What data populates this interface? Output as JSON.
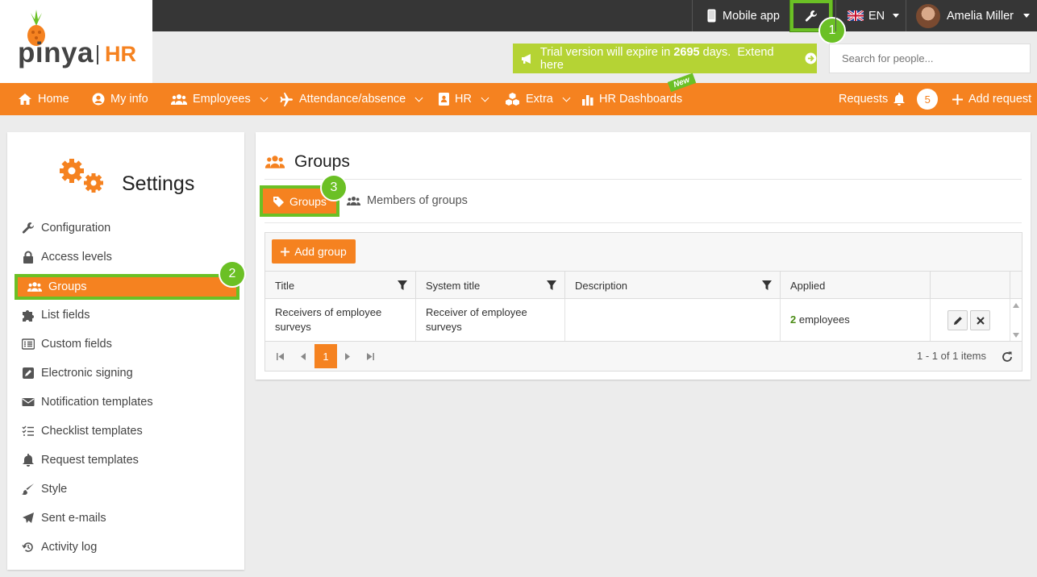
{
  "brand": {
    "name": "pinya",
    "suffix": "HR",
    "brand_color": "#f58220",
    "accent_green": "#6bc025"
  },
  "topbar": {
    "mobile_app": "Mobile app",
    "language": "EN",
    "user_name": "Amelia Miller"
  },
  "callouts": {
    "one": "1",
    "two": "2",
    "three": "3"
  },
  "trial": {
    "prefix": "Trial version will expire in",
    "days": "2695",
    "suffix": "days.",
    "link": "Extend here"
  },
  "search": {
    "placeholder": "Search for people..."
  },
  "nav": {
    "home": "Home",
    "my_info": "My info",
    "employees": "Employees",
    "attendance": "Attendance/absence",
    "hr": "HR",
    "extra": "Extra",
    "dashboards": "HR Dashboards",
    "new_tag": "New",
    "requests": "Requests",
    "requests_count": "5",
    "add_request": "Add request"
  },
  "sidebar": {
    "title": "Settings",
    "items": [
      {
        "label": "Configuration",
        "icon": "wrench-icon"
      },
      {
        "label": "Access levels",
        "icon": "lock-icon"
      },
      {
        "label": "Groups",
        "icon": "users-icon",
        "active": true
      },
      {
        "label": "List fields",
        "icon": "puzzle-icon"
      },
      {
        "label": "Custom fields",
        "icon": "list-icon"
      },
      {
        "label": "Electronic signing",
        "icon": "sign-icon"
      },
      {
        "label": "Notification templates",
        "icon": "envelope-icon"
      },
      {
        "label": "Checklist templates",
        "icon": "checklist-icon"
      },
      {
        "label": "Request templates",
        "icon": "bell-icon"
      },
      {
        "label": "Style",
        "icon": "brush-icon"
      },
      {
        "label": "Sent e-mails",
        "icon": "paper-plane-icon"
      },
      {
        "label": "Activity log",
        "icon": "history-icon"
      }
    ]
  },
  "main": {
    "title": "Groups",
    "tabs": [
      {
        "label": "Groups",
        "active": true
      },
      {
        "label": "Members of groups"
      }
    ],
    "add_button": "Add group",
    "columns": [
      "Title",
      "System title",
      "Description",
      "Applied"
    ],
    "rows": [
      {
        "title": "Receivers of employee surveys",
        "system_title": "Receiver of employee surveys",
        "description": "",
        "applied_count": "2",
        "applied_unit": "employees"
      }
    ],
    "pager": {
      "current": "1",
      "info": "1 - 1 of 1 items"
    }
  }
}
